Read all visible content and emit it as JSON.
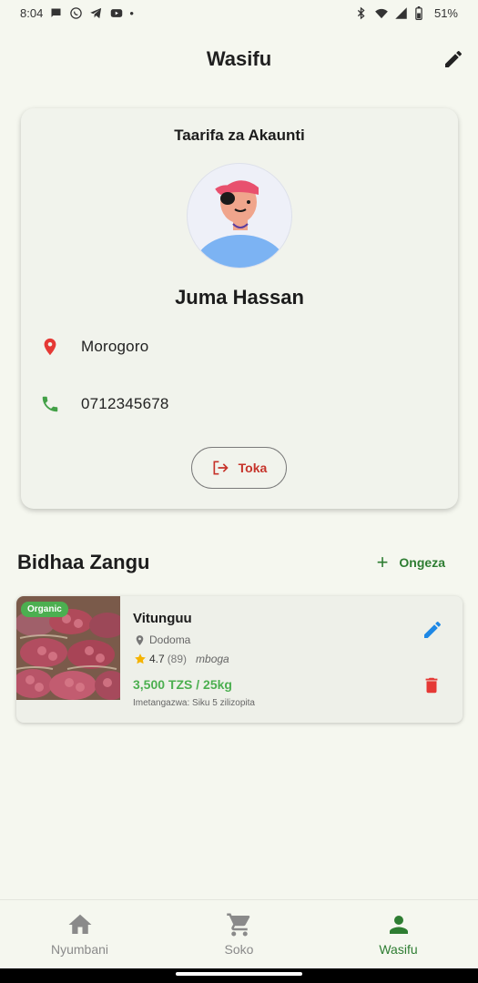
{
  "status_bar": {
    "time": "8:04",
    "battery": "51%",
    "dot": "•"
  },
  "app_bar": {
    "title": "Wasifu",
    "edit_icon": "pencil-icon"
  },
  "account": {
    "card_title": "Taarifa za Akaunti",
    "name": "Juma Hassan",
    "location": "Morogoro",
    "phone": "0712345678",
    "logout_label": "Toka",
    "colors": {
      "location_icon": "#e53935",
      "phone_icon": "#43a047",
      "logout": "#c6332a"
    }
  },
  "products_section": {
    "title": "Bidhaa Zangu",
    "add_label": "Ongeza",
    "add_symbol": "+",
    "items": [
      {
        "badge": "Organic",
        "name": "Vitunguu",
        "location": "Dodoma",
        "rating": "4.7",
        "rating_count": "(89)",
        "category": "mboga",
        "price": "3,500 TZS / 25kg",
        "posted": "Imetangazwa: Siku 5 zilizopita"
      }
    ]
  },
  "bottom_nav": {
    "items": [
      {
        "label": "Nyumbani",
        "icon": "home-icon"
      },
      {
        "label": "Soko",
        "icon": "cart-icon"
      },
      {
        "label": "Wasifu",
        "icon": "person-icon",
        "active": true
      }
    ],
    "active_color": "#2e7d32"
  }
}
